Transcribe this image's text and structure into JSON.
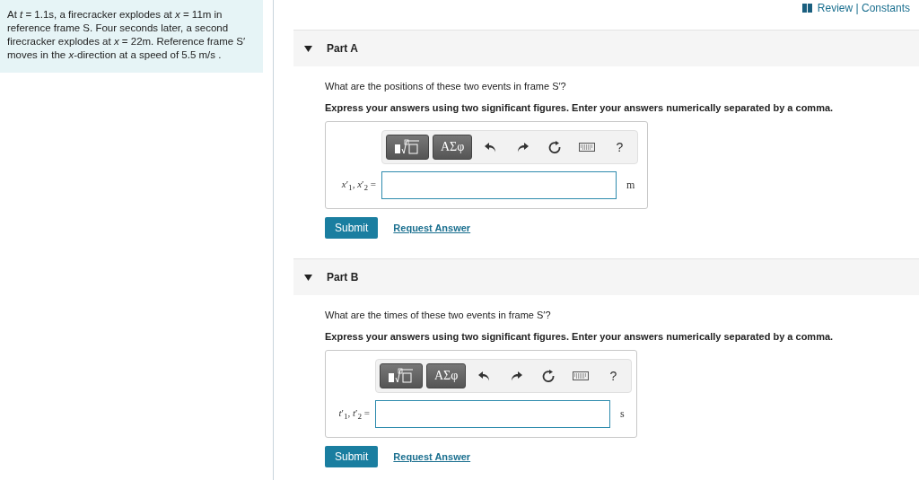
{
  "header_link": "Review | Constants",
  "problem": "At *t* = 1.1s, a firecracker explodes at *x* = 11m in reference frame S. Four seconds later, a second firecracker explodes at *x* = 22m. Reference frame S′ moves in the *x*-direction at a speed of 5.5 m/s .",
  "parts": [
    {
      "title": "Part A",
      "expanded": true,
      "question": "What are the positions of these two events in frame S′?",
      "instruction": "Express your answers using two significant figures. Enter your answers numerically separated by a comma.",
      "toolbar": {
        "greek": "ΑΣφ",
        "help": "?"
      },
      "label": "*x*′$_{1}$, *x*′$_{2}$ =",
      "unit": "m",
      "submit": "Submit",
      "request": "Request Answer"
    },
    {
      "title": "Part B",
      "expanded": true,
      "question": "What are the times of these two events in frame S′?",
      "instruction": "Express your answers using two significant figures. Enter your answers numerically separated by a comma.",
      "toolbar": {
        "greek": "ΑΣφ",
        "help": "?"
      },
      "label": "*t*′$_{1}$, *t*′$_{2}$ =",
      "unit": "s",
      "submit": "Submit",
      "request": "Request Answer"
    }
  ]
}
